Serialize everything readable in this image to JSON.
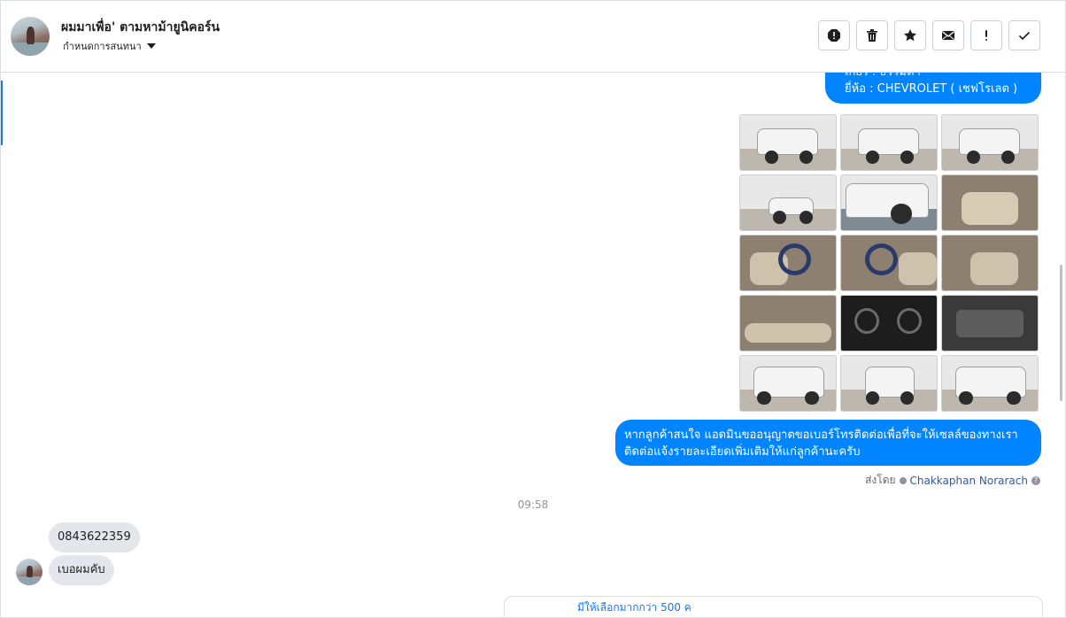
{
  "header": {
    "name": "ผมมาเพื่อ' ตามหาม้ายูนิคอร์น",
    "status_label": "กำหนดการสนทนา",
    "actions": [
      {
        "icon": "spam-icon"
      },
      {
        "icon": "trash-icon"
      },
      {
        "icon": "star-icon"
      },
      {
        "icon": "envelope-icon"
      },
      {
        "icon": "exclamation-icon"
      },
      {
        "icon": "check-icon"
      }
    ]
  },
  "messages": {
    "car_info": {
      "line_partial": "เกียร์ : ธรรมดา",
      "line_brand": "ยี่ห้อ : CHEVROLET ( เชฟโรเลต )"
    },
    "photos_count": 15,
    "reply_text_line1": "หากลูกค้าสนใจ แอดมินขออนุญาตขอเบอร์โทรติดต่อเพื่อที่จะให้เซลล์ของทางเรา",
    "reply_text_line2": "ติดต่อแจ้งรายละเอียดเพิ่มเติมให้แก่ลูกค้านะครับ",
    "sent_by_prefix": "ส่งโดย",
    "sent_by_name": "Chakkaphan Norarach",
    "timestamp": "09:58",
    "incoming_1": "0843622359",
    "incoming_2": "เบอผมคับ"
  },
  "bottom_card": {
    "text": "มีให้เลือกมากกว่า 500 ค"
  },
  "colors": {
    "outgoing_bubble": "#0084ff",
    "incoming_bubble": "#e4e6eb",
    "accent": "#1877f2"
  }
}
